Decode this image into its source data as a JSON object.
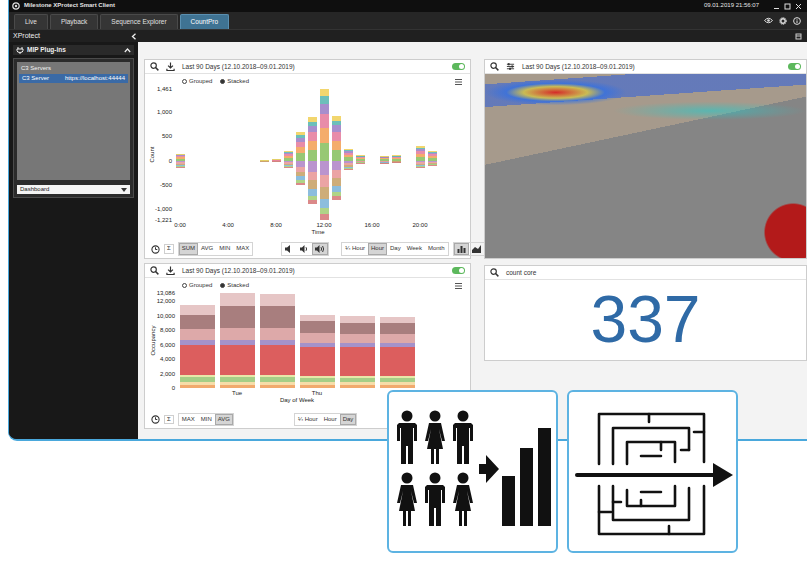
{
  "window": {
    "title": "Milestone XProtect Smart Client",
    "clock": "09.01.2019 21:56:07"
  },
  "tabs": [
    {
      "label": "Live",
      "selected": false
    },
    {
      "label": "Playback",
      "selected": false
    },
    {
      "label": "Sequence Explorer",
      "selected": false
    },
    {
      "label": "CountPro",
      "selected": true
    }
  ],
  "panel_bar": {
    "title": "XProtect"
  },
  "sidebar": {
    "header": "MIP Plug-ins",
    "group": "C3 Servers",
    "servers": [
      {
        "name": "C3 Server",
        "url": "https://localhost:44444",
        "selected": true
      }
    ],
    "view": "Dashboard"
  },
  "charts": [
    {
      "period": "Last 90 Days (12.10.2018–09.01.2019)",
      "enabled": true,
      "modes": [
        {
          "label": "Grouped",
          "selected": false
        },
        {
          "label": "Stacked",
          "selected": true
        }
      ],
      "y_title": "Count",
      "x_title": "Time",
      "y_ticks": [
        {
          "label": "1,461",
          "value": 1461
        },
        {
          "label": "1,000",
          "value": 1000
        },
        {
          "label": "500",
          "value": 500
        },
        {
          "label": "0",
          "value": 0
        },
        {
          "label": "-500",
          "value": -500
        },
        {
          "label": "-1,000",
          "value": -1000
        },
        {
          "label": "-1,221",
          "value": -1221
        }
      ],
      "x_ticks": [
        {
          "label": "0:00",
          "index": 0
        },
        {
          "label": "4:00",
          "index": 4
        },
        {
          "label": "8:00",
          "index": 8
        },
        {
          "label": "12:00",
          "index": 12
        },
        {
          "label": "16:00",
          "index": 16
        },
        {
          "label": "20:00",
          "index": 20
        }
      ],
      "series": [
        {
          "color": "#8cc265",
          "values": [
            38,
            0,
            0,
            0,
            0,
            0,
            0,
            5,
            8,
            50,
            150,
            225,
            365,
            225,
            63,
            25,
            0,
            25,
            25,
            0,
            75,
            50,
            0,
            0
          ]
        },
        {
          "color": "#f3a35c",
          "values": [
            30,
            0,
            0,
            0,
            0,
            0,
            0,
            4,
            6,
            40,
            120,
            180,
            292,
            180,
            50,
            20,
            0,
            20,
            20,
            0,
            60,
            40,
            0,
            0
          ]
        },
        {
          "color": "#e57fa0",
          "values": [
            25,
            0,
            0,
            0,
            0,
            0,
            0,
            3,
            5,
            45,
            110,
            170,
            292,
            190,
            45,
            25,
            0,
            20,
            25,
            0,
            55,
            40,
            0,
            0
          ]
        },
        {
          "color": "#9d82c8",
          "values": [
            22,
            0,
            0,
            0,
            0,
            0,
            0,
            3,
            4,
            30,
            90,
            135,
            219,
            135,
            37,
            15,
            0,
            15,
            15,
            0,
            45,
            30,
            0,
            0
          ]
        },
        {
          "color": "#5cb8b2",
          "values": [
            15,
            0,
            0,
            0,
            0,
            0,
            0,
            2,
            3,
            20,
            60,
            90,
            146,
            90,
            25,
            10,
            0,
            10,
            10,
            0,
            30,
            20,
            0,
            0
          ]
        },
        {
          "color": "#f1d15e",
          "values": [
            15,
            0,
            0,
            0,
            0,
            0,
            0,
            2,
            3,
            20,
            60,
            90,
            147,
            90,
            25,
            10,
            0,
            10,
            10,
            0,
            30,
            20,
            0,
            0
          ]
        },
        {
          "color": "#b388c9",
          "values": [
            -38,
            0,
            0,
            0,
            0,
            0,
            0,
            -3,
            -5,
            -38,
            -125,
            -225,
            -305,
            -200,
            -50,
            -13,
            0,
            -15,
            -10,
            0,
            -38,
            -25,
            0,
            0
          ]
        },
        {
          "color": "#e99a9a",
          "values": [
            -30,
            0,
            0,
            0,
            0,
            0,
            0,
            -2,
            -4,
            -30,
            -100,
            -180,
            -244,
            -160,
            -40,
            -10,
            0,
            -12,
            -8,
            0,
            -30,
            -20,
            0,
            0
          ]
        },
        {
          "color": "#c9a46a",
          "values": [
            -30,
            0,
            0,
            0,
            0,
            0,
            0,
            -2,
            -4,
            -30,
            -100,
            -180,
            -244,
            -160,
            -40,
            -10,
            0,
            -12,
            -8,
            0,
            -30,
            -20,
            0,
            0
          ]
        },
        {
          "color": "#7fb6d9",
          "values": [
            -22,
            0,
            0,
            0,
            0,
            0,
            0,
            -1,
            -3,
            -22,
            -75,
            -135,
            -184,
            -120,
            -30,
            -7,
            0,
            -9,
            -6,
            0,
            -22,
            -15,
            0,
            0
          ]
        },
        {
          "color": "#a6cf7a",
          "values": [
            -15,
            0,
            0,
            0,
            0,
            0,
            0,
            -1,
            -2,
            -15,
            -50,
            -90,
            -122,
            -80,
            -20,
            -5,
            0,
            -6,
            -4,
            0,
            -15,
            -10,
            0,
            0
          ]
        },
        {
          "color": "#d77c7c",
          "values": [
            -15,
            0,
            0,
            0,
            0,
            0,
            0,
            -1,
            -2,
            -15,
            -50,
            -90,
            -122,
            -80,
            -20,
            -5,
            0,
            -6,
            -4,
            0,
            -15,
            -10,
            0,
            0
          ]
        }
      ],
      "sigma": "Σ",
      "aggregates": [
        {
          "label": "SUM",
          "selected": true
        },
        {
          "label": "AVG",
          "selected": false
        },
        {
          "label": "MIN",
          "selected": false
        },
        {
          "label": "MAX",
          "selected": false
        }
      ],
      "audio": [
        {
          "kind": "speaker",
          "selected": false
        },
        {
          "kind": "speaker-wave",
          "selected": false
        },
        {
          "kind": "speaker-waves",
          "selected": true
        }
      ],
      "intervals": [
        {
          "label": "¼ Hour",
          "selected": false
        },
        {
          "label": "Hour",
          "selected": true
        },
        {
          "label": "Day",
          "selected": false
        },
        {
          "label": "Week",
          "selected": false
        },
        {
          "label": "Month",
          "selected": false
        }
      ],
      "chart_types": [
        {
          "kind": "bar",
          "selected": true
        },
        {
          "kind": "area",
          "selected": false
        },
        {
          "kind": "line",
          "selected": false
        }
      ]
    },
    {
      "period": "Last 90 Days (12.10.2018–09.01.2019)",
      "enabled": true,
      "modes": [
        {
          "label": "Grouped",
          "selected": false
        },
        {
          "label": "Stacked",
          "selected": true
        }
      ],
      "y_title": "Occupancy",
      "x_title": "Day of Week",
      "y_ticks": [
        {
          "label": "13,086",
          "value": 13086
        },
        {
          "label": "12,000",
          "value": 12000
        },
        {
          "label": "10,000",
          "value": 10000
        },
        {
          "label": "8,000",
          "value": 8000
        },
        {
          "label": "6,000",
          "value": 6000
        },
        {
          "label": "4,000",
          "value": 4000
        },
        {
          "label": "2,000",
          "value": 2000
        },
        {
          "label": "0",
          "value": 0
        }
      ],
      "x_ticks": [
        {
          "label": "Tue",
          "index": 1
        },
        {
          "label": "Thu",
          "index": 3
        }
      ],
      "series": [
        {
          "color": "#f0a15e",
          "values": [
            500,
            500,
            500,
            500,
            500,
            500
          ]
        },
        {
          "color": "#f5d9a0",
          "values": [
            300,
            300,
            300,
            300,
            300,
            300
          ]
        },
        {
          "color": "#9cc97a",
          "values": [
            700,
            700,
            700,
            600,
            600,
            600
          ]
        },
        {
          "color": "#e6e6a0",
          "values": [
            300,
            300,
            300,
            300,
            300,
            300
          ]
        },
        {
          "color": "#d84c4c",
          "values": [
            4200,
            4200,
            4200,
            4000,
            4000,
            4000
          ]
        },
        {
          "color": "#9b86c4",
          "values": [
            600,
            600,
            600,
            500,
            500,
            500
          ]
        },
        {
          "color": "#d9a0a0",
          "values": [
            1500,
            1700,
            1700,
            1400,
            1300,
            1300
          ]
        },
        {
          "color": "#9e7070",
          "values": [
            2000,
            3000,
            3000,
            1600,
            1500,
            1500
          ]
        },
        {
          "color": "#e3c0c0",
          "values": [
            1300,
            1786,
            1700,
            900,
            900,
            800
          ]
        }
      ],
      "sigma": "Σ",
      "aggregates": [
        {
          "label": "MAX",
          "selected": false
        },
        {
          "label": "MIN",
          "selected": false
        },
        {
          "label": "AVG",
          "selected": true
        }
      ],
      "intervals": [
        {
          "label": "¼ Hour",
          "selected": false
        },
        {
          "label": "Hour",
          "selected": false
        },
        {
          "label": "Day",
          "selected": true
        }
      ]
    }
  ],
  "camera": {
    "period": "Last 90 Days (12.10.2018–09.01.2019)",
    "enabled": true
  },
  "counter": {
    "title": "count core",
    "value": "337"
  }
}
